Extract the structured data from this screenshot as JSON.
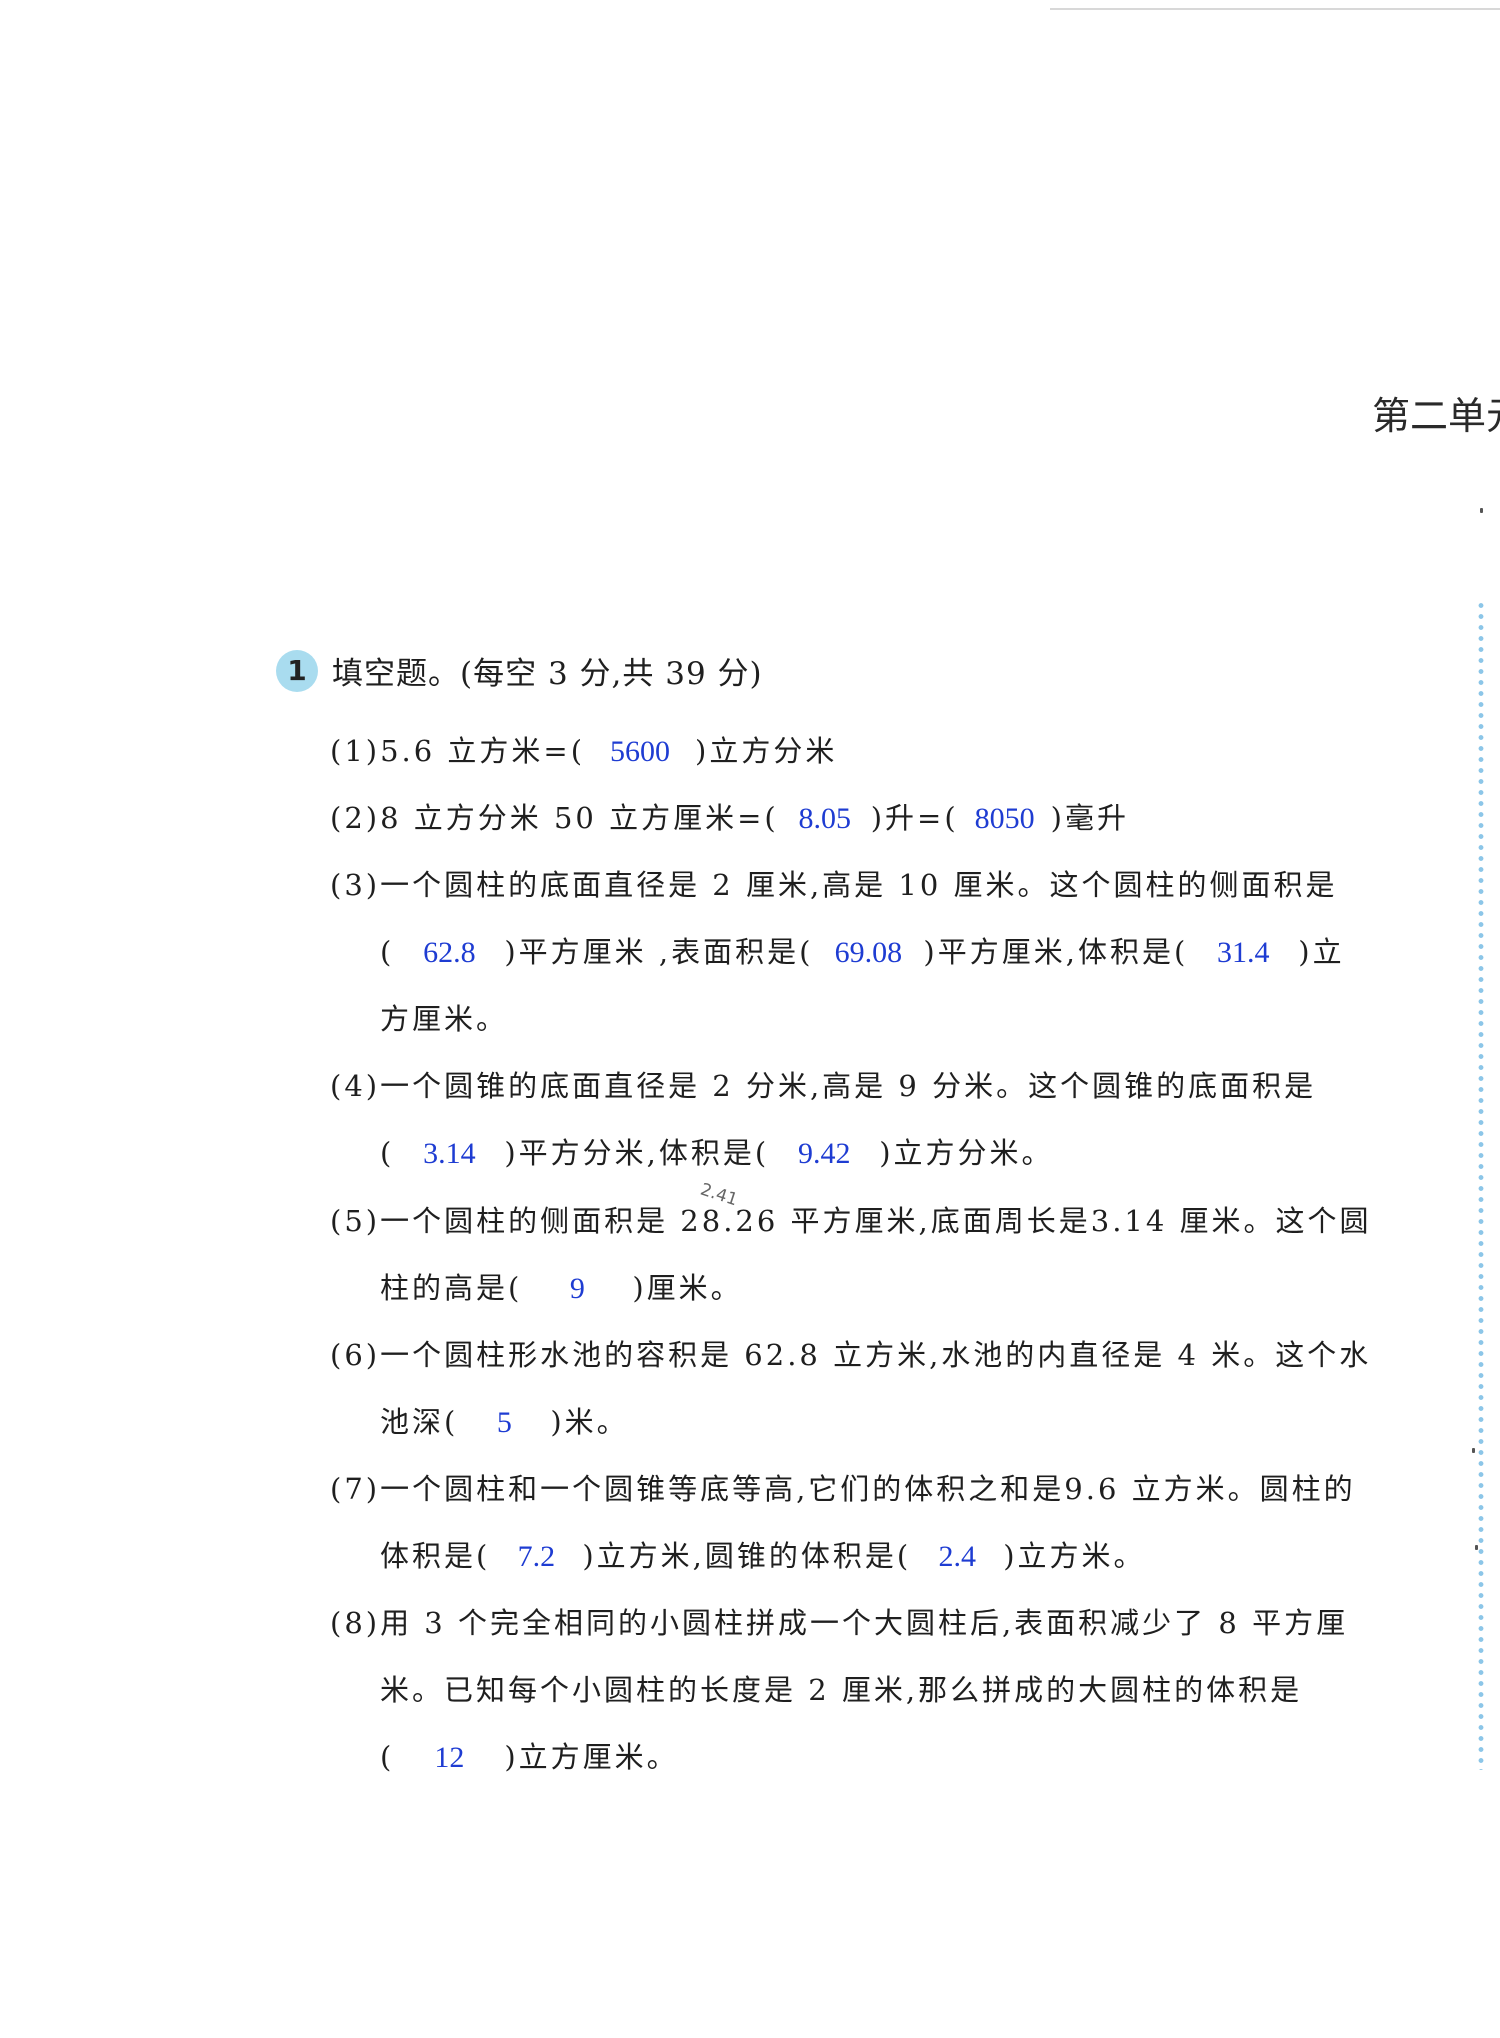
{
  "header": {
    "unit_title": "第二单元"
  },
  "section": {
    "number": "1",
    "title": "填空题。(每空 3 分,共 39 分)"
  },
  "q1": {
    "pre": "(1)5.6 立方米=(",
    "a1": "5600",
    "post": ")立方分米"
  },
  "q2": {
    "pre": "(2)8 立方分米 50 立方厘米=(",
    "a1": "8.05",
    "mid": ")升=(",
    "a2": "8050",
    "post": ")毫升"
  },
  "q3": {
    "line1": "(3)一个圆柱的底面直径是 2 厘米,高是 10 厘米。这个圆柱的侧面积是",
    "open": "(",
    "a1": "62.8",
    "mid1": ")平方厘米 ,表面积是(",
    "a2": "69.08",
    "mid2": ")平方厘米,体积是(",
    "a3": "31.4",
    "post": ")立",
    "line3": "方厘米。"
  },
  "q4": {
    "line1": "(4)一个圆锥的底面直径是 2 分米,高是 9 分米。这个圆锥的底面积是",
    "open": "(",
    "a1": "3.14",
    "mid": ")平方分米,体积是(",
    "a2": "9.42",
    "post": ")立方分米。"
  },
  "q5": {
    "line1": "(5)一个圆柱的侧面积是 28.26 平方厘米,底面周长是3.14 厘米。这个圆",
    "pre": "柱的高是(",
    "a1": "9",
    "post": ")厘米。",
    "scribble": "2.41"
  },
  "q6": {
    "line1": "(6)一个圆柱形水池的容积是 62.8 立方米,水池的内直径是 4 米。这个水",
    "pre": "池深(",
    "a1": "5",
    "post": ")米。"
  },
  "q7": {
    "line1": "(7)一个圆柱和一个圆锥等底等高,它们的体积之和是9.6 立方米。圆柱的",
    "pre": "体积是(",
    "a1": "7.2",
    "mid": ")立方米,圆锥的体积是(",
    "a2": "2.4",
    "post": ")立方米。"
  },
  "q8": {
    "line1": "(8)用 3 个完全相同的小圆柱拼成一个大圆柱后,表面积减少了 8 平方厘",
    "line2": "米。已知每个小圆柱的长度是 2 厘米,那么拼成的大圆柱的体积是",
    "open": "(",
    "a1": "12",
    "post": ")立方厘米。"
  }
}
